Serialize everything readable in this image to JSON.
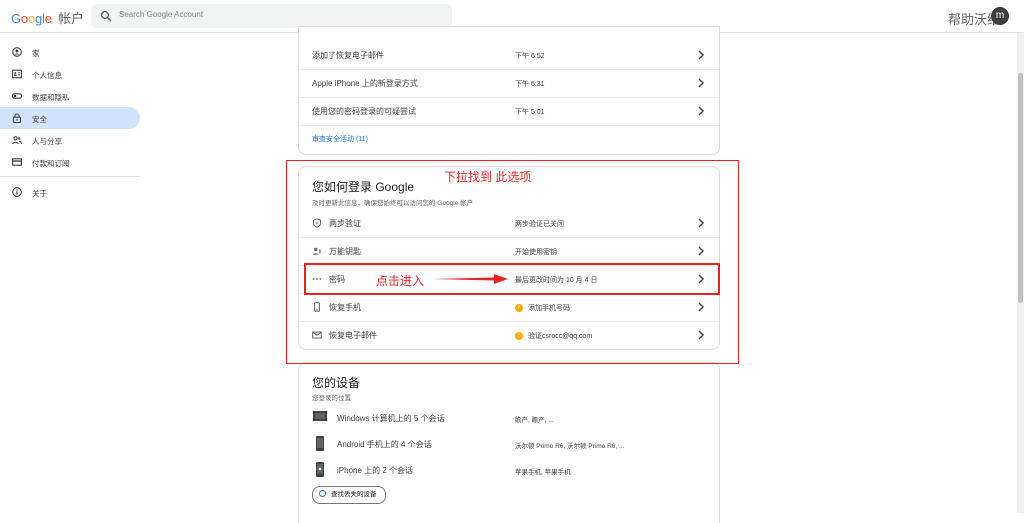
{
  "header": {
    "logo_google": "Google",
    "logo_account": "帐户",
    "search_placeholder": "Search Google Account",
    "help_text": "帮助沃维",
    "avatar_letter": "m"
  },
  "sidebar": {
    "items": [
      {
        "label": "家",
        "icon": "home-icon"
      },
      {
        "label": "个人信息",
        "icon": "id-card-icon"
      },
      {
        "label": "数据和隐私",
        "icon": "toggle-icon"
      },
      {
        "label": "安全",
        "icon": "lock-icon",
        "active": true
      },
      {
        "label": "人与分享",
        "icon": "people-icon"
      },
      {
        "label": "付款和订阅",
        "icon": "credit-card-icon"
      }
    ],
    "about": {
      "label": "关于",
      "icon": "info-icon"
    }
  },
  "activity": {
    "rows": [
      {
        "label": "添加了恢复电子邮件",
        "time": "下午 6:52"
      },
      {
        "label": "Apple iPhone 上的新登录方式",
        "time": "下午 6:31"
      },
      {
        "label": "使用您的密码登录的可疑尝试",
        "time": "下午 5:01"
      }
    ],
    "review_link": "审查安全活动 (11)"
  },
  "signin": {
    "title": "您如何登录 Google",
    "subtitle": "及时更新此信息，确保您始终可以访问您的 Google 帐户",
    "rows": [
      {
        "label": "两步验证",
        "value": "两步验证已关闭",
        "icon": "shield-icon"
      },
      {
        "label": "万能钥匙",
        "value": "开始使用密钥",
        "icon": "passkey-icon"
      },
      {
        "label": "密码",
        "value": "最后更改时间为 10 月 4 日",
        "icon": "password-dots-icon"
      },
      {
        "label": "恢复手机",
        "value": "添加手机号码",
        "icon": "phone-icon",
        "warn": true
      },
      {
        "label": "恢复电子邮件",
        "value": "验证csrocc@qq.com",
        "icon": "mail-icon",
        "warn": true
      }
    ]
  },
  "devices": {
    "title": "您的设备",
    "subtitle": "您登录的位置",
    "rows": [
      {
        "label": "Windows 计算机上的 5 个会话",
        "value": "瞻产, 瞻产, ...",
        "icon": "laptop-icon"
      },
      {
        "label": "Android 手机上的 4 个会话",
        "value": "沃尔顿 Primo R6, 沃尔顿 Primo R6, ...",
        "icon": "android-phone-icon"
      },
      {
        "label": "iPhone 上的 2 个会话",
        "value": "苹果手机, 苹果手机",
        "icon": "iphone-icon"
      }
    ],
    "find_button": "查找丢失的设备"
  },
  "annotations": {
    "scroll_hint": "下拉找到 此选项",
    "click_hint": "点击进入",
    "color": "#e52424"
  },
  "colors": {
    "accent": "#1a73e8",
    "active_nav": "#d3e3fd",
    "warning": "#f9ab00"
  }
}
